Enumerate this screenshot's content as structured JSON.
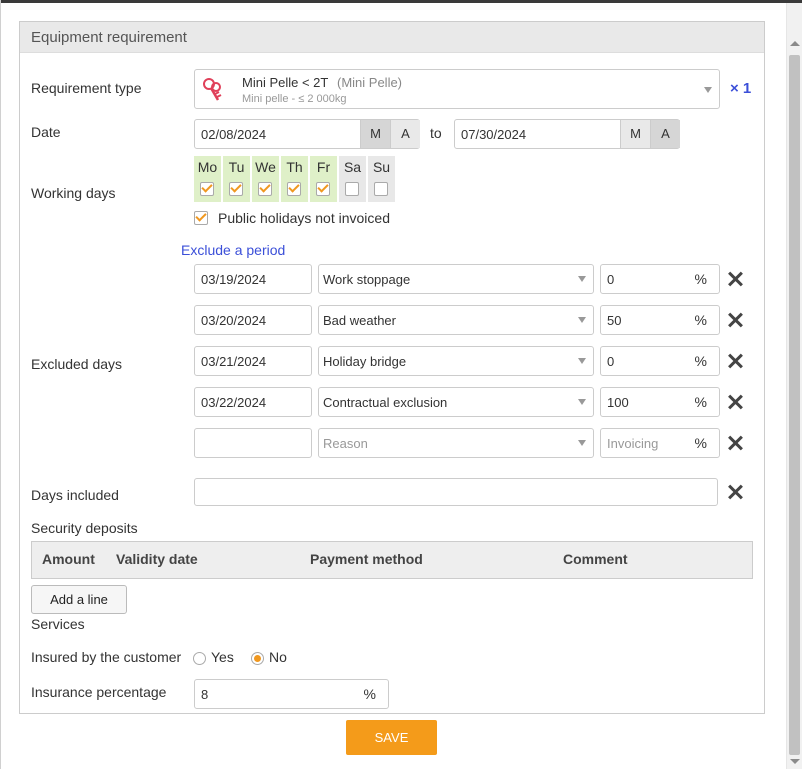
{
  "panel_title": "Equipment requirement",
  "requirement": {
    "label": "Requirement type",
    "name": "Mini Pelle < 2T",
    "category": "(Mini Pelle)",
    "subtitle": "Mini pelle - ≤ 2 000kg",
    "quantity": "× 1",
    "icon": "keys-icon"
  },
  "date": {
    "label": "Date",
    "from": "02/08/2024",
    "to_label": "to",
    "to": "07/30/2024",
    "btn_m": "M",
    "btn_a": "A"
  },
  "working_days": {
    "label": "Working days",
    "days": [
      {
        "name": "Mo",
        "checked": true
      },
      {
        "name": "Tu",
        "checked": true
      },
      {
        "name": "We",
        "checked": true
      },
      {
        "name": "Th",
        "checked": true
      },
      {
        "name": "Fr",
        "checked": true
      },
      {
        "name": "Sa",
        "checked": false
      },
      {
        "name": "Su",
        "checked": false
      }
    ],
    "public_holidays_label": "Public holidays not invoiced",
    "public_holidays_checked": true
  },
  "excluded": {
    "link": "Exclude a period",
    "label": "Excluded days",
    "rows": [
      {
        "date": "03/19/2024",
        "reason": "Work stoppage",
        "invoicing": "0",
        "pct": "%"
      },
      {
        "date": "03/20/2024",
        "reason": "Bad weather",
        "invoicing": "50",
        "pct": "%"
      },
      {
        "date": "03/21/2024",
        "reason": "Holiday bridge",
        "invoicing": "0",
        "pct": "%"
      },
      {
        "date": "03/22/2024",
        "reason": "Contractual exclusion",
        "invoicing": "100",
        "pct": "%"
      }
    ],
    "new_row": {
      "date": "",
      "reason_placeholder": "Reason",
      "invoicing_placeholder": "Invoicing",
      "pct": "%"
    }
  },
  "days_included": {
    "label": "Days included",
    "value": ""
  },
  "deposits": {
    "label": "Security deposits",
    "columns": [
      "Amount",
      "Validity date",
      "Payment method",
      "Comment"
    ],
    "add_line": "Add a line"
  },
  "services": {
    "label": "Services",
    "insured_label": "Insured by the customer",
    "yes": "Yes",
    "no": "No",
    "selected": "No",
    "insurance_label": "Insurance percentage",
    "insurance_value": "8",
    "insurance_unit": "%"
  },
  "save_label": "SAVE",
  "colors": {
    "accent": "#f49b1a",
    "link": "#3b4fd8",
    "working_day_bg": "#dff0c8"
  }
}
